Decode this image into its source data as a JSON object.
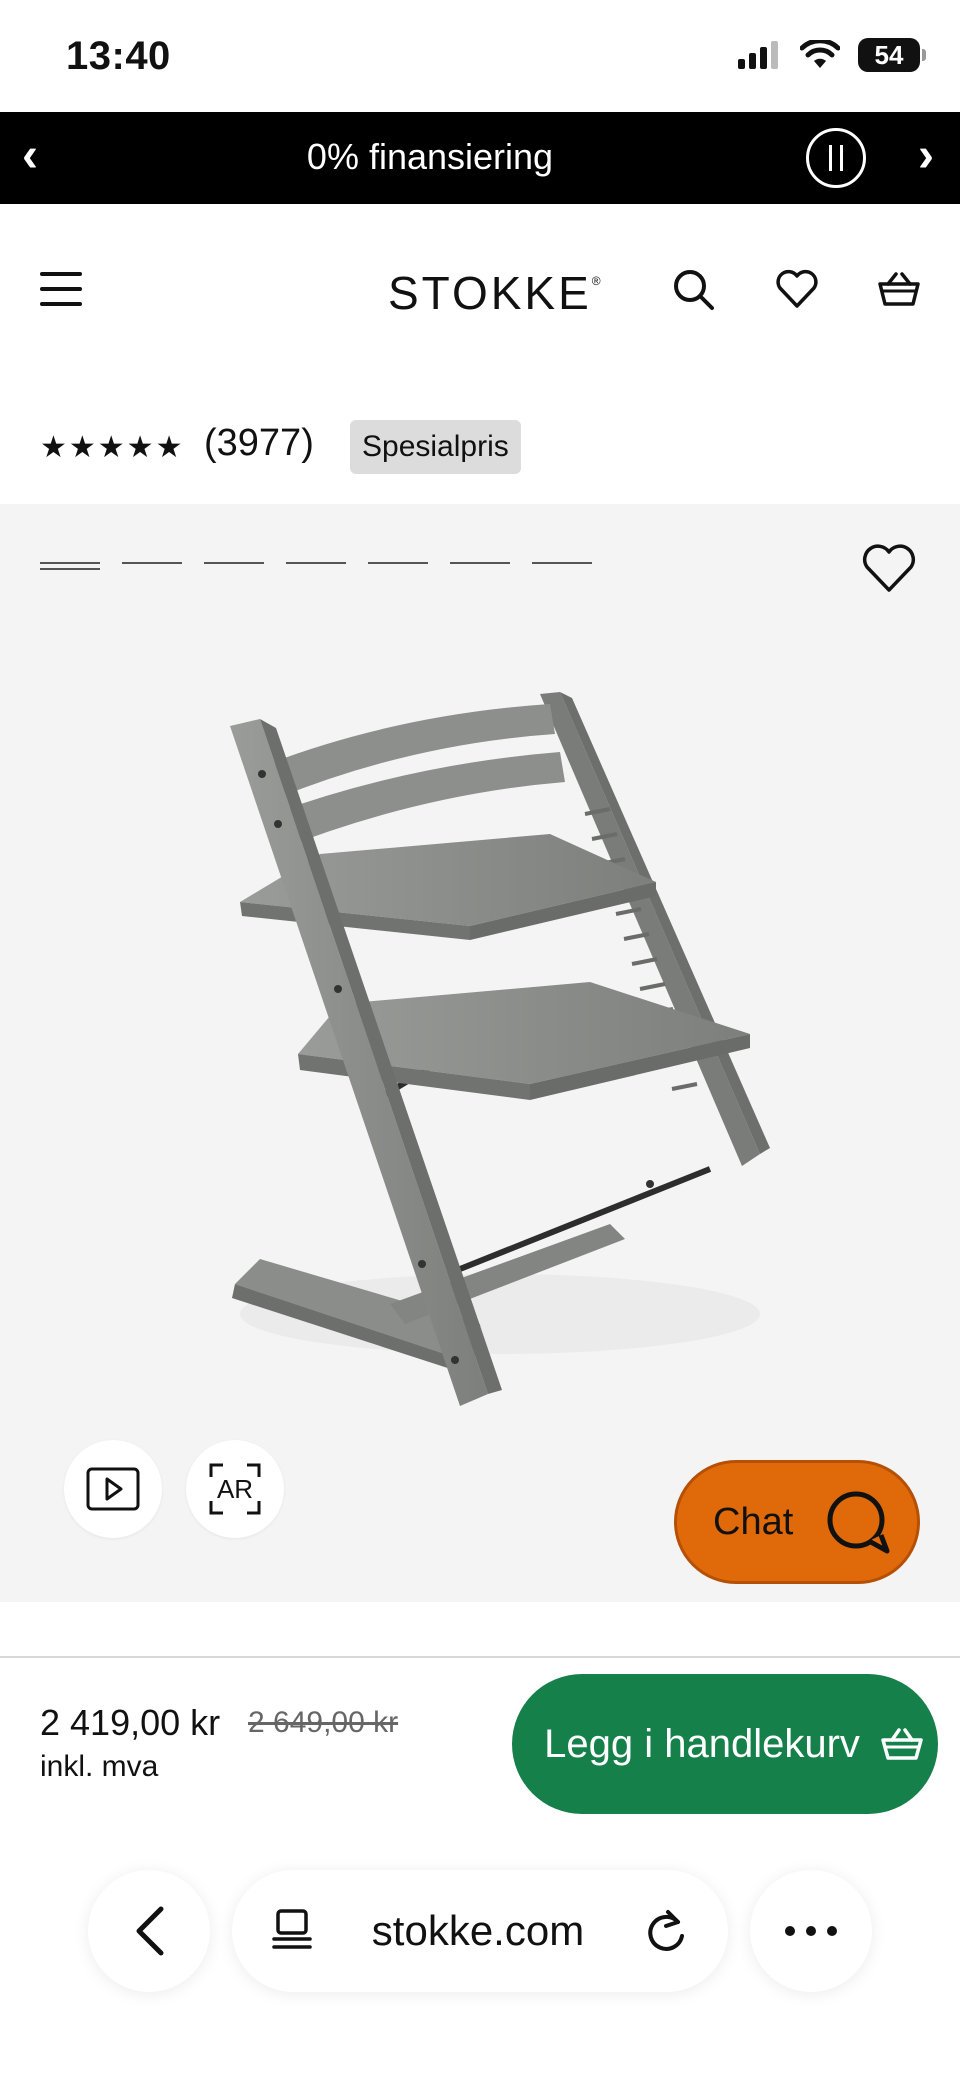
{
  "status": {
    "time": "13:40",
    "battery": "54"
  },
  "promo": {
    "text": "0% finansiering",
    "prev": "‹",
    "next": "›"
  },
  "header": {
    "logo": "STOKKE",
    "logo_mark": "®"
  },
  "rating": {
    "stars": "★★★★★",
    "count": "(3977)",
    "badge": "Spesialpris"
  },
  "gallery": {
    "dot_count": 7,
    "active_dot": 0,
    "ar_label": "AR"
  },
  "chat": {
    "label": "Chat"
  },
  "pricing": {
    "price": "2 419,00 kr",
    "old_price": "2 649,00 kr",
    "vat": "inkl. mva"
  },
  "cart": {
    "label": "Legg i handlekurv"
  },
  "browser": {
    "url": "stokke.com"
  },
  "colors": {
    "promo_bg": "#000000",
    "cart_green": "#15804a",
    "chat_orange": "#e06a0a",
    "badge_bg": "#dcdcdc",
    "chair_gray": "#8a8c89"
  },
  "icons": [
    "menu-icon",
    "search-icon",
    "heart-icon",
    "basket-icon",
    "play-icon",
    "ar-icon",
    "chat-icon",
    "back-icon",
    "tabs-icon",
    "reload-icon",
    "more-icon",
    "pause-icon"
  ]
}
